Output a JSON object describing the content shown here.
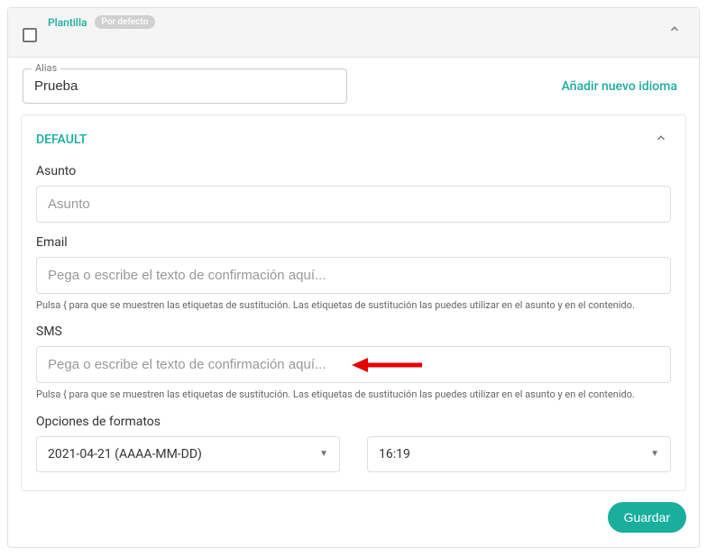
{
  "header": {
    "plantilla": "Plantilla",
    "default_badge": "Por defecto"
  },
  "alias": {
    "label": "Alias",
    "value": "Prueba"
  },
  "add_language": "Añadir nuevo idioma",
  "default_section": {
    "title": "DEFAULT",
    "asunto": {
      "label": "Asunto",
      "placeholder": "Asunto",
      "value": ""
    },
    "email": {
      "label": "Email",
      "placeholder": "Pega o escribe el texto de confirmación aquí...",
      "helper": "Pulsa { para que se muestren las etiquetas de sustitución. Las etiquetas de sustitución las puedes utilizar en el asunto y en el contenido.",
      "value": ""
    },
    "sms": {
      "label": "SMS",
      "placeholder": "Pega o escribe el texto de confirmación aquí...",
      "helper": "Pulsa { para que se muestren las etiquetas de sustitución. Las etiquetas de sustitución las puedes utilizar en el asunto y en el contenido.",
      "value": ""
    },
    "format_options": {
      "label": "Opciones de formatos",
      "date": "2021-04-21 (AAAA-MM-DD)",
      "time": "16:19"
    }
  },
  "save": "Guardar"
}
